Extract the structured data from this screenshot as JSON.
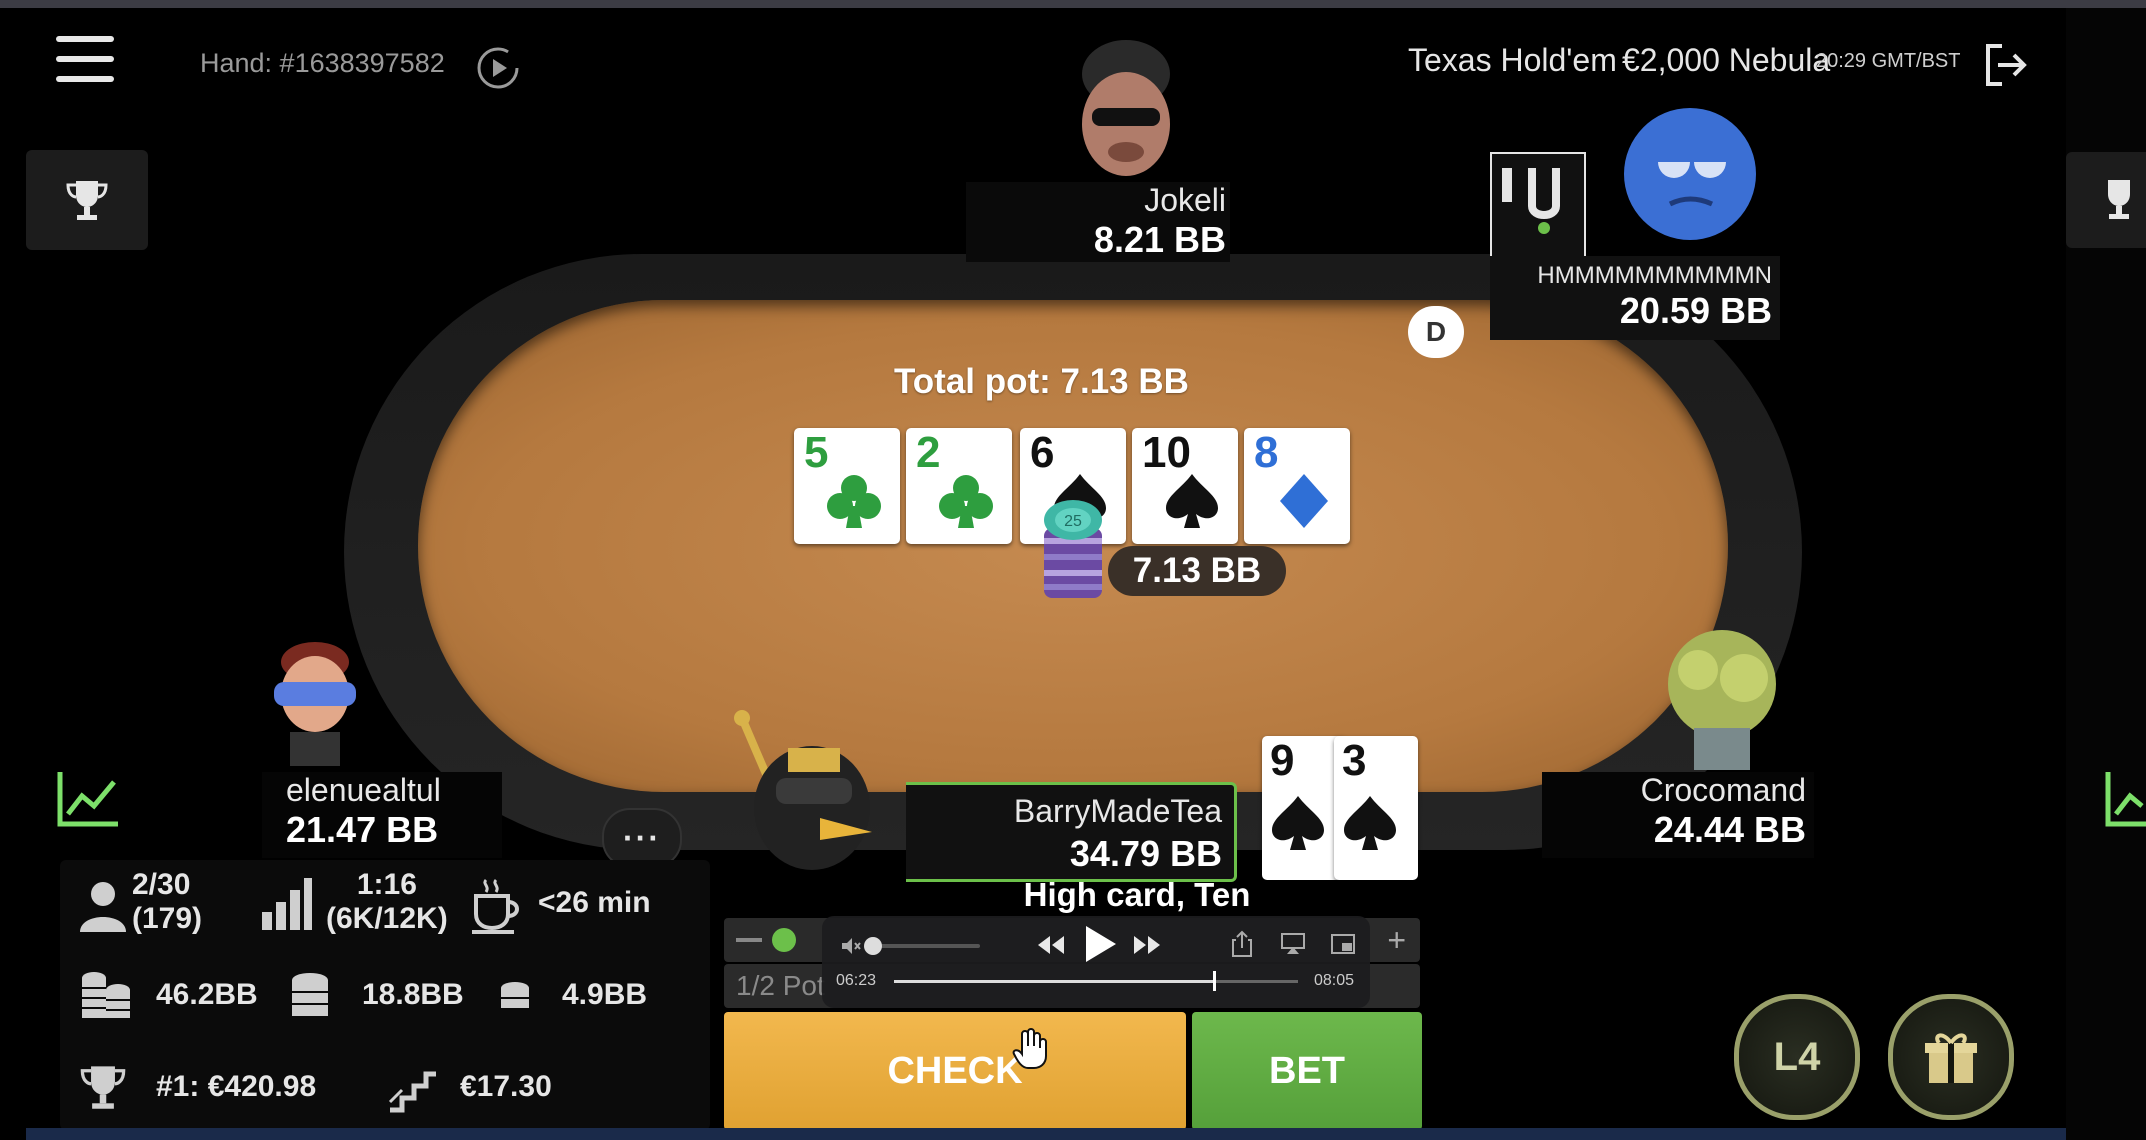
{
  "header": {
    "hand_label": "Hand: #1638397582",
    "game": "Texas Hold'em",
    "stake_table": "€2,000 Nebula",
    "time": "20:29 GMT/BST"
  },
  "pot": {
    "total_label": "Total pot: 7.13 BB",
    "chip_amount": "7.13 BB",
    "chip_denomination": "25"
  },
  "board": [
    {
      "rank": "5",
      "suit": "club",
      "color": "#2e9e3f"
    },
    {
      "rank": "2",
      "suit": "club",
      "color": "#2e9e3f"
    },
    {
      "rank": "6",
      "suit": "spade",
      "color": "#111111"
    },
    {
      "rank": "10",
      "suit": "spade",
      "color": "#111111"
    },
    {
      "rank": "8",
      "suit": "diamond",
      "color": "#2f6fd6"
    }
  ],
  "dealer_button": "D",
  "players": {
    "top": {
      "name": "Jokeli",
      "stack": "8.21 BB"
    },
    "top_right": {
      "name": "HMMMMMMMMMMN",
      "stack": "20.59 BB"
    },
    "left": {
      "name": "elenuealtul",
      "stack": "21.47 BB"
    },
    "right": {
      "name": "Crocomand",
      "stack": "24.44 BB"
    },
    "hero": {
      "name": "BarryMadeTea",
      "stack": "34.79 BB",
      "hand_desc": "High card, Ten"
    }
  },
  "hero_cards": [
    {
      "rank": "9",
      "suit": "spade"
    },
    {
      "rank": "3",
      "suit": "spade"
    }
  ],
  "stats": {
    "players_rank": "2/30",
    "players_total": "(179)",
    "blinds": "1:16",
    "blinds_amount": "(6K/12K)",
    "break_time": "<26 min",
    "largest_stack": "46.2BB",
    "avg_stack": "18.8BB",
    "smallest_stack": "4.9BB",
    "first_prize": "#1: €420.98",
    "next_payout": "€17.30"
  },
  "actions": {
    "check": "CHECK",
    "bet": "BET",
    "preset": "1/2 Pot"
  },
  "video": {
    "elapsed": "06:23",
    "duration": "08:05",
    "progress": 0.79
  },
  "level_badge": "L4",
  "more_dots": "···"
}
